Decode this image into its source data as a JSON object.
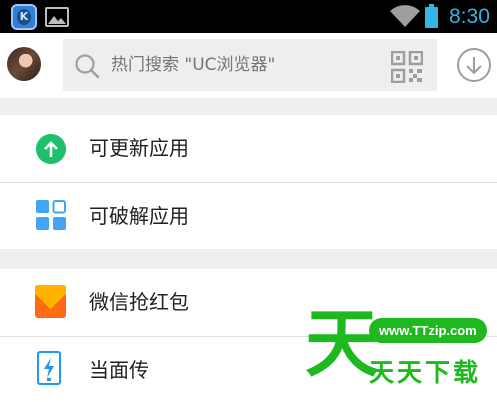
{
  "status_bar": {
    "time": "8:30",
    "app_icon_letter": "K",
    "accent_color": "#33b5e5"
  },
  "header": {
    "search_placeholder": "热门搜索 \"UC浏览器\"",
    "icons": [
      "avatar",
      "search-icon",
      "qr-code-icon",
      "download-icon"
    ]
  },
  "menu": {
    "items": [
      {
        "label": "可更新应用",
        "icon": "update-arrow-icon",
        "color": "#1ec16b"
      },
      {
        "label": "可破解应用",
        "icon": "grid-icon",
        "color": "#42a5f5"
      },
      {
        "label": "微信抢红包",
        "icon": "red-packet-icon",
        "color": "#ff6a13"
      },
      {
        "label": "当面传",
        "icon": "phone-transfer-icon",
        "color": "#2196f3"
      }
    ]
  },
  "watermark": {
    "big_char": "天",
    "url": "www.TTzip.com",
    "text": "天天下载",
    "color": "#1eb91e"
  }
}
